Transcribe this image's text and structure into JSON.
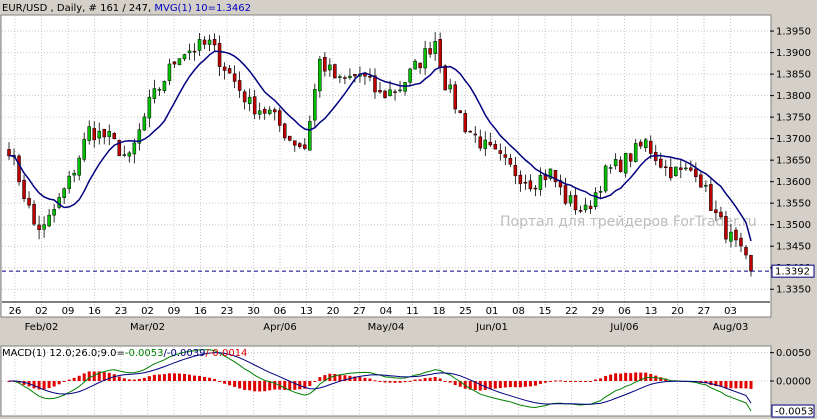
{
  "header": {
    "symbol": "EUR/USD",
    "info": " , Daily, # 161 / 247, ",
    "indicator": "MVG(1) 10=1.3462"
  },
  "macd_header": {
    "prefix": "MACD(1) 12.0;26.0;9.0=",
    "v1": "-0.0053",
    "v2": "/-0.0039",
    "v3": "/-0.0014"
  },
  "watermark": "Портал для трейдеров ForTrader.ru",
  "colors": {
    "up_candle": "#00c000",
    "down_candle": "#c00000",
    "ma_line": "#000080",
    "macd_line": "#008000",
    "signal_line": "#000080",
    "hist": "#e00000",
    "current_line": "#000080"
  },
  "chart_data": [
    {
      "type": "candlestick",
      "title": "EUR/USD , Daily",
      "ylim": [
        1.3325,
        1.3985
      ],
      "y_ticks": [
        "1.3950",
        "1.3900",
        "1.3850",
        "1.3800",
        "1.3750",
        "1.3700",
        "1.3650",
        "1.3600",
        "1.3550",
        "1.3500",
        "1.3450",
        "1.3400",
        "1.3350"
      ],
      "current_price": "1.3392",
      "x_day_ticks": [
        "26",
        "02",
        "09",
        "16",
        "23",
        "02",
        "09",
        "16",
        "23",
        "30",
        "06",
        "13",
        "20",
        "27",
        "04",
        "11",
        "18",
        "25",
        "01",
        "08",
        "15",
        "22",
        "29",
        "06",
        "13",
        "20",
        "27",
        "03"
      ],
      "x_month_labels": [
        {
          "text": "Feb/02",
          "at_day": "02"
        },
        {
          "text": "Mar/02",
          "at_day": "02"
        },
        {
          "text": "Apr/06",
          "at_day": "06"
        },
        {
          "text": "May/04",
          "at_day": "04"
        },
        {
          "text": "Jun/01",
          "at_day": "01"
        },
        {
          "text": "Jul/06",
          "at_day": "06"
        },
        {
          "text": "Aug/03",
          "at_day": "03"
        }
      ],
      "anchors": [
        [
          0,
          1.368
        ],
        [
          5,
          1.35
        ],
        [
          7,
          1.349
        ],
        [
          12,
          1.36
        ],
        [
          16,
          1.372
        ],
        [
          20,
          1.37
        ],
        [
          24,
          1.365
        ],
        [
          28,
          1.378
        ],
        [
          34,
          1.39
        ],
        [
          40,
          1.392
        ],
        [
          44,
          1.385
        ],
        [
          48,
          1.378
        ],
        [
          52,
          1.376
        ],
        [
          56,
          1.37
        ],
        [
          59,
          1.368
        ],
        [
          62,
          1.388
        ],
        [
          66,
          1.383
        ],
        [
          70,
          1.385
        ],
        [
          74,
          1.38
        ],
        [
          78,
          1.382
        ],
        [
          82,
          1.388
        ],
        [
          85,
          1.393
        ],
        [
          87,
          1.383
        ],
        [
          91,
          1.373
        ],
        [
          95,
          1.368
        ],
        [
          100,
          1.363
        ],
        [
          104,
          1.36
        ],
        [
          108,
          1.362
        ],
        [
          111,
          1.356
        ],
        [
          115,
          1.353
        ],
        [
          119,
          1.362
        ],
        [
          123,
          1.365
        ],
        [
          127,
          1.369
        ],
        [
          131,
          1.363
        ],
        [
          134,
          1.362
        ],
        [
          137,
          1.363
        ],
        [
          141,
          1.352
        ],
        [
          145,
          1.345
        ],
        [
          148,
          1.3392
        ]
      ],
      "ma_period": 10,
      "ma_value": "1.3462"
    },
    {
      "type": "macd",
      "params": "12.0;26.0;9.0",
      "ylim": [
        -0.006,
        0.006
      ],
      "y_ticks": [
        "0.0050",
        "0.0000"
      ],
      "current_value": "-0.0053",
      "macd": "-0.0053",
      "signal": "-0.0039",
      "histogram": "-0.0014"
    }
  ]
}
